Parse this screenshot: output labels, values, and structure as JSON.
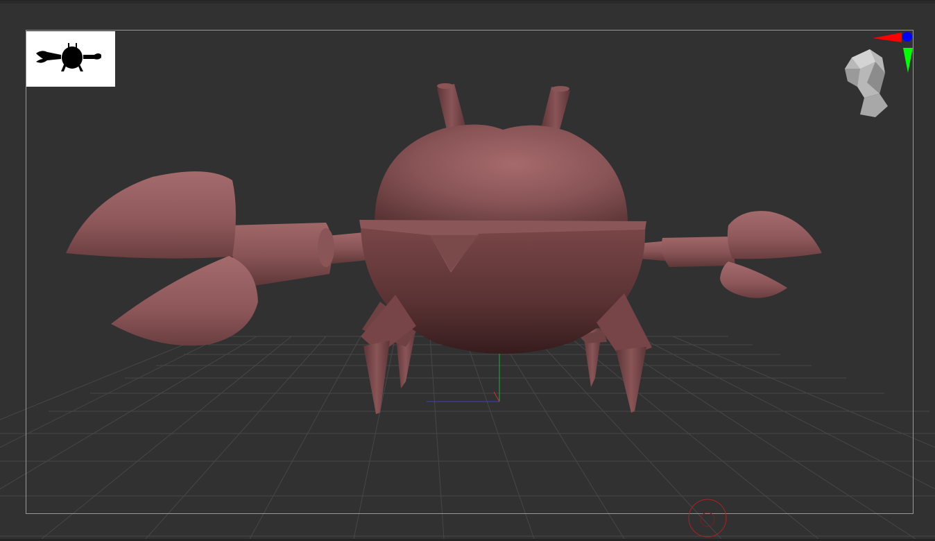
{
  "viewport": {
    "background_color": "#313131",
    "floor_grid": true,
    "floor_grid_color": "#4a4a4a",
    "model_color": "#8e5a5b",
    "frame_color": "#9a9a9a"
  },
  "thumbnail": {
    "background_color": "#ffffff",
    "silhouette_color": "#000000",
    "icon": "crab-silhouette-icon"
  },
  "navigation": {
    "icon": "head-orientation-icon",
    "axis_colors": {
      "x": "#ff0000",
      "y": "#00ff00",
      "z": "#0000ff"
    }
  },
  "axes": {
    "x_color": "#3d3dc8",
    "y_color": "#1faa3c",
    "z_color": "#d03030"
  },
  "floor_gizmo": {
    "icon": "floor-gizmo-icon",
    "color": "#b02020"
  }
}
